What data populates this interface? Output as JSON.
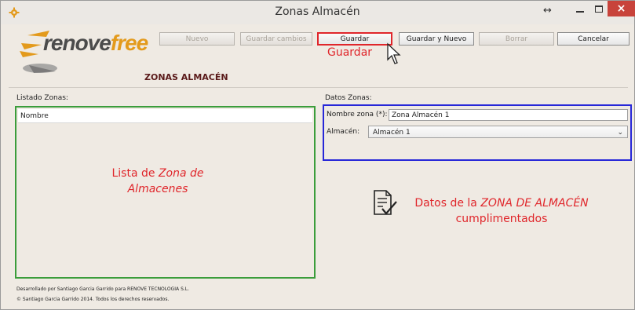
{
  "window": {
    "title": "Zonas Almacén",
    "close_glyph": "×",
    "resize_glyph": "↔"
  },
  "logo": {
    "part1": "renove",
    "part2": "free",
    "brand_color": "#e39a1c"
  },
  "section_title": "ZONAS ALMACÉN",
  "toolbar": {
    "nuevo": "Nuevo",
    "guardar_cambios": "Guardar cambios",
    "guardar": "Guardar",
    "guardar_y_nuevo": "Guardar y Nuevo",
    "borrar": "Borrar",
    "cancelar": "Cancelar"
  },
  "annotations": {
    "guardar": "Guardar",
    "lista_line1_a": "Lista de ",
    "lista_line1_b": "Zona de",
    "lista_line2": "Almacenes",
    "datos_line1_a": "Datos de la ",
    "datos_line1_b": "ZONA DE ALMACÉN",
    "datos_line2": "cumplimentados",
    "color": "#e0262b"
  },
  "list": {
    "label": "Listado Zonas:",
    "column_header": "Nombre"
  },
  "form": {
    "label": "Datos Zonas:",
    "name_label": "Nombre zona (*):",
    "name_value": "Zona Almacén 1",
    "warehouse_label": "Almacén:",
    "warehouse_value": "Almacén 1"
  },
  "footer": {
    "line1": "Desarrollado por Santiago Garcia Garrido para RENOVE TECNOLOGIA S.L.",
    "line2": "© Santiago Garcia Garrido 2014. Todos los derechos reservados."
  }
}
